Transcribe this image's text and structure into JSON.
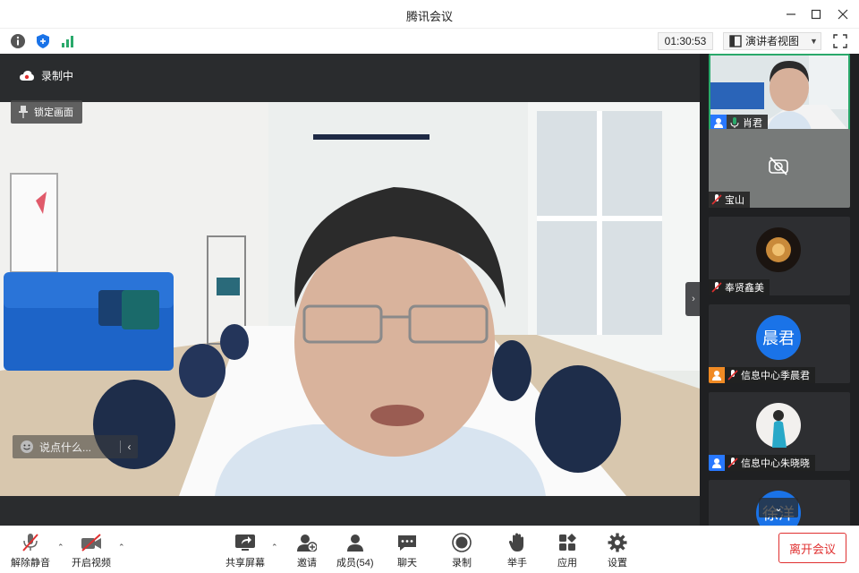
{
  "window": {
    "title": "腾讯会议"
  },
  "toolbar": {
    "timer": "01:30:53",
    "view_mode": "演讲者视图"
  },
  "stage": {
    "recording_label": "录制中",
    "lock_label": "锁定画面",
    "chat_placeholder": "说点什么..."
  },
  "participants": [
    {
      "name": "肖君"
    },
    {
      "name": "宝山"
    },
    {
      "name": "奉贤鑫美"
    },
    {
      "name": "信息中心季晨君",
      "avatar_text": "晨君"
    },
    {
      "name": "信息中心朱晓晓"
    },
    {
      "name": "",
      "avatar_text": "徐洋"
    }
  ],
  "controls": {
    "unmute": "解除静音",
    "start_video": "开启视频",
    "share_screen": "共享屏幕",
    "invite": "邀请",
    "members": "成员(54)",
    "chat": "聊天",
    "record": "录制",
    "raise_hand": "举手",
    "apps": "应用",
    "settings": "设置",
    "leave": "离开会议"
  },
  "colors": {
    "accent_blue": "#1a73e8",
    "danger_red": "#e03030",
    "active_green": "#2aa96b"
  }
}
